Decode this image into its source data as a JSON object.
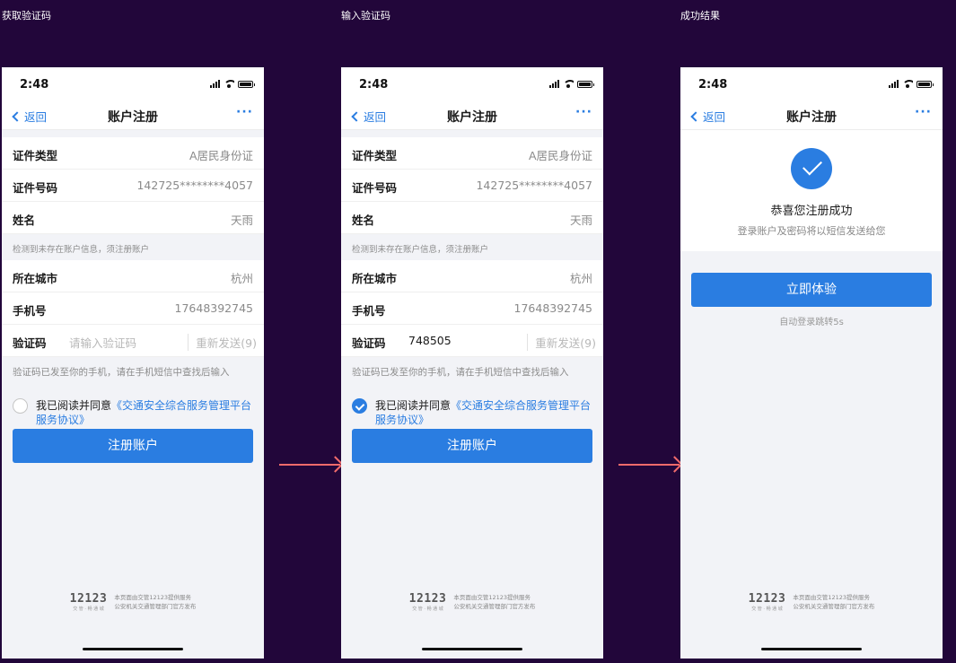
{
  "steps": [
    "获取验证码",
    "输入验证码",
    "成功结果"
  ],
  "status": {
    "time": "2:48"
  },
  "nav": {
    "back": "返回",
    "title": "账户注册",
    "more": "···"
  },
  "form": {
    "id_type_label": "证件类型",
    "id_type_value": "A居民身份证",
    "id_no_label": "证件号码",
    "id_no_value": "142725********4057",
    "name_label": "姓名",
    "name_value": "天雨",
    "hint": "检测到未存在账户信息，须注册账户",
    "city_label": "所在城市",
    "city_value": "杭州",
    "phone_label": "手机号",
    "phone_value": "17648392745",
    "code_label": "验证码",
    "code_placeholder": "请输入验证码",
    "code_value": "748505",
    "resend": "重新发送(9)",
    "sent_hint": "验证码已发至你的手机，请在手机短信中查找后输入",
    "agree_prefix": "我已阅读并同意",
    "agree_link": "《交通安全综合服务管理平台服务协议》",
    "submit": "注册账户"
  },
  "success": {
    "title": "恭喜您注册成功",
    "subtitle": "登录账户及密码将以短信发送给您",
    "button": "立即体验",
    "auto": "自动登录跳转5s"
  },
  "footer": {
    "logo": "12123",
    "logo_sub": "交 管 · 畅 通 城",
    "line1": "本页面由交管12123提供服务",
    "line2": "公安机关交通管理部门官方发布"
  },
  "colors": {
    "background": "#22063a",
    "accent": "#2a7de1",
    "arrow": "#f06b6b"
  },
  "icons": [
    "signal-icon",
    "wifi-icon",
    "battery-icon",
    "back-chevron-icon",
    "more-icon",
    "checkbox-icon",
    "success-check-icon"
  ]
}
